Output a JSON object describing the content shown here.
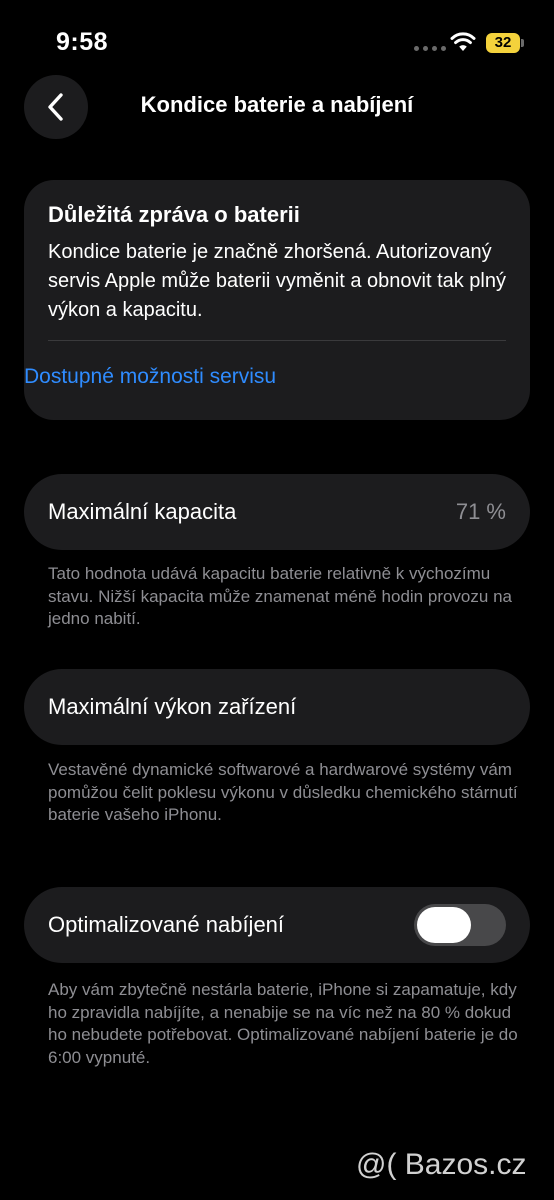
{
  "status_bar": {
    "time": "9:58",
    "battery_level": "32"
  },
  "nav": {
    "title": "Kondice baterie a nabíjení",
    "back_icon": "chevron-left-icon"
  },
  "alert": {
    "title": "Důležitá zpráva o baterii",
    "body": "Kondice baterie je značně zhoršená. Autorizovaný servis Apple může baterii vyměnit a obnovit tak plný výkon a kapacitu.",
    "link": "Dostupné možnosti servisu"
  },
  "capacity": {
    "label": "Maximální kapacita",
    "value": "71 %",
    "footnote": "Tato hodnota udává kapacitu baterie relativně k výchozímu stavu. Nižší kapacita může znamenat méně hodin provozu na jedno nabití."
  },
  "performance": {
    "label": "Maximální výkon zařízení",
    "footnote": "Vestavěné dynamické softwarové a hardwarové systémy vám pomůžou čelit poklesu výkonu v důsledku chemického stárnutí baterie vašeho iPhonu."
  },
  "optimized": {
    "label": "Optimalizované nabíjení",
    "toggle_on": false,
    "footnote": "Aby vám zbytečně nestárla baterie, iPhone si zapamatuje, kdy ho zpravidla nabíjíte, a nenabije se na víc než na 80 % dokud ho nebudete potřebovat. Optimalizované nabíjení baterie je do 6:00 vypnuté."
  },
  "watermark": "@( Bazos.cz",
  "colors": {
    "background": "#000000",
    "card": "#1c1c1e",
    "link": "#2f8cff",
    "secondary_text": "#8e8e93",
    "battery": "#f4d23c",
    "toggle_off_track": "#48484a"
  }
}
